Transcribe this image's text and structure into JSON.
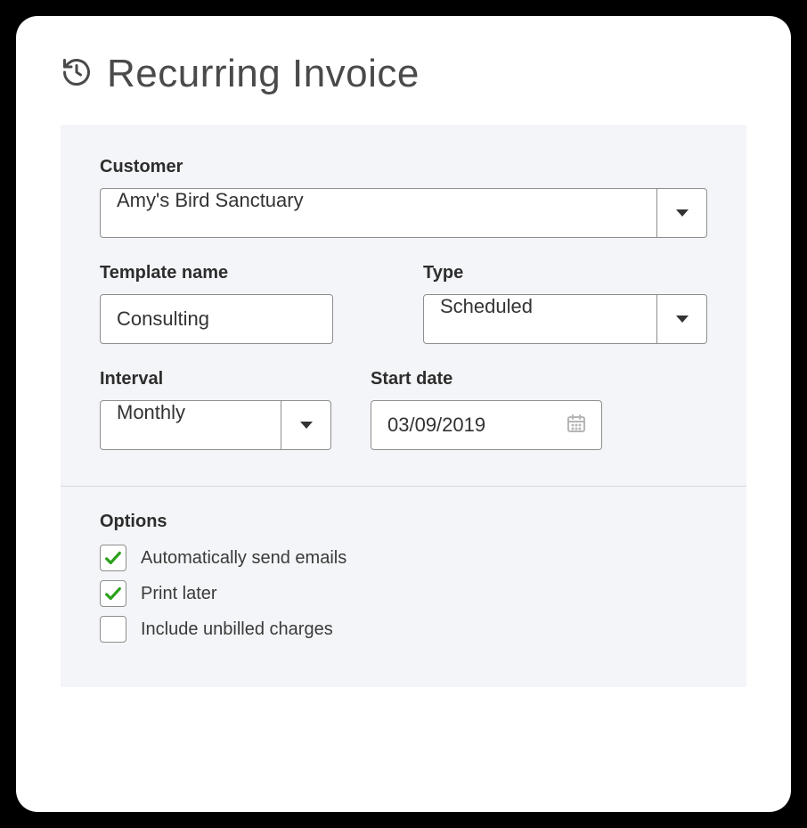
{
  "title": "Recurring Invoice",
  "form": {
    "customer": {
      "label": "Customer",
      "value": "Amy's Bird Sanctuary"
    },
    "template": {
      "label": "Template name",
      "value": "Consulting"
    },
    "type": {
      "label": "Type",
      "value": "Scheduled"
    },
    "interval": {
      "label": "Interval",
      "value": "Monthly"
    },
    "start_date": {
      "label": "Start date",
      "value": "03/09/2019"
    }
  },
  "options": {
    "title": "Options",
    "items": [
      {
        "label": "Automatically send emails",
        "checked": true
      },
      {
        "label": "Print later",
        "checked": true
      },
      {
        "label": "Include unbilled charges",
        "checked": false
      }
    ]
  },
  "colors": {
    "check_green": "#2ca01c",
    "panel_bg": "#f4f5f8",
    "border": "#8e8e8e"
  }
}
